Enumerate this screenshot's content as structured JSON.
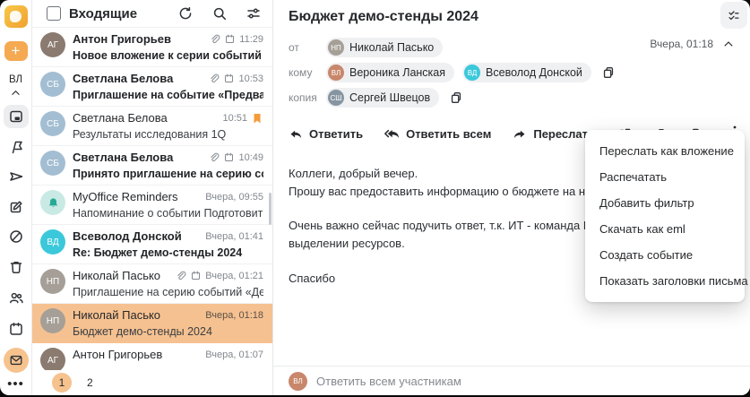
{
  "sidebar": {
    "user_initials": "ВЛ"
  },
  "list": {
    "title": "Входящие",
    "rows": [
      {
        "sender": "Антон Григорьев",
        "subject": "Новое вложение к серии событий «Аналити...",
        "time": "11:29",
        "initials": "АГ",
        "avatar_color": "#8A7A6F"
      },
      {
        "sender": "Светлана Белова",
        "subject": "Приглашение на событие «Предварительно...",
        "time": "10:53",
        "initials": "СБ",
        "avatar_color": "#A3BED2"
      },
      {
        "sender": "Светлана Белова",
        "subject": "Результаты исследования 1Q",
        "time": "10:51",
        "initials": "СБ",
        "avatar_color": "#A3BED2"
      },
      {
        "sender": "Светлана Белова",
        "subject": "Принято приглашение на серию событий «...",
        "time": "10:49",
        "initials": "СБ",
        "avatar_color": "#A3BED2"
      },
      {
        "sender": "MyOffice Reminders",
        "subject": "Напоминание о событии Подготовить отчет...",
        "time": "Вчера, 09:55",
        "initials": "",
        "avatar_color": "#C9EAE4"
      },
      {
        "sender": "Всеволод Донской",
        "subject": "Re: Бюджет демо-стенды 2024",
        "time": "Вчера, 01:41",
        "initials": "ВД",
        "avatar_color": "#3BC8DB"
      },
      {
        "sender": "Николай Пасько",
        "subject": "Приглашение на серию событий «Демо стен...",
        "time": "Вчера, 01:21",
        "initials": "НП",
        "avatar_color": "#A59F97"
      },
      {
        "sender": "Николай Пасько",
        "subject": "Бюджет демо-стенды 2024",
        "time": "Вчера, 01:18",
        "initials": "НП",
        "avatar_color": "#A59F97"
      },
      {
        "sender": "Антон Григорьев",
        "time": "Вчера, 01:07",
        "initials": "АГ",
        "avatar_color": "#8A7A6F"
      }
    ],
    "pagination": {
      "current": "1",
      "next": "2"
    }
  },
  "detail": {
    "subject": "Бюджет демо-стенды 2024",
    "date": "Вчера, 01:18",
    "from_label": "от",
    "to_label": "кому",
    "cc_label": "копия",
    "from_chip": {
      "name": "Николай Пасько",
      "initials": "НП",
      "color": "#A59F97"
    },
    "to_chip1": {
      "name": "Вероника Ланская",
      "initials": "ВЛ",
      "color": "#C8876B"
    },
    "to_chip2": {
      "name": "Всеволод Донской",
      "initials": "ВД",
      "color": "#3BC8DB"
    },
    "cc_chip": {
      "name": "Сергей Швецов",
      "initials": "СШ",
      "color": "#8795A1"
    },
    "toolbar": {
      "reply": "Ответить",
      "reply_all": "Ответить всем",
      "forward": "Переслать"
    },
    "body": {
      "p1a": "Коллеги, добрый вечер.",
      "p1b": "Прошу вас предоставить информацию о бюджете на наши демонстраци",
      "p2a": "Очень важно сейчас подучить ответ, т.к. ИТ - команда Всеволода, уже",
      "p2b": "выделении ресурсов.",
      "p3": "Спасибо"
    },
    "reply_bar": {
      "placeholder": "Ответить всем участникам",
      "avatar_initials": "ВЛ",
      "avatar_color": "#C8876B"
    }
  },
  "menu": {
    "items": [
      "Переслать как вложение",
      "Распечатать",
      "Добавить фильтр",
      "Скачать как eml",
      "Создать событие",
      "Показать заголовки письма"
    ]
  },
  "colors": {
    "accent": "#F5A951",
    "selection": "#F6C190",
    "flag": "#F59B38"
  }
}
